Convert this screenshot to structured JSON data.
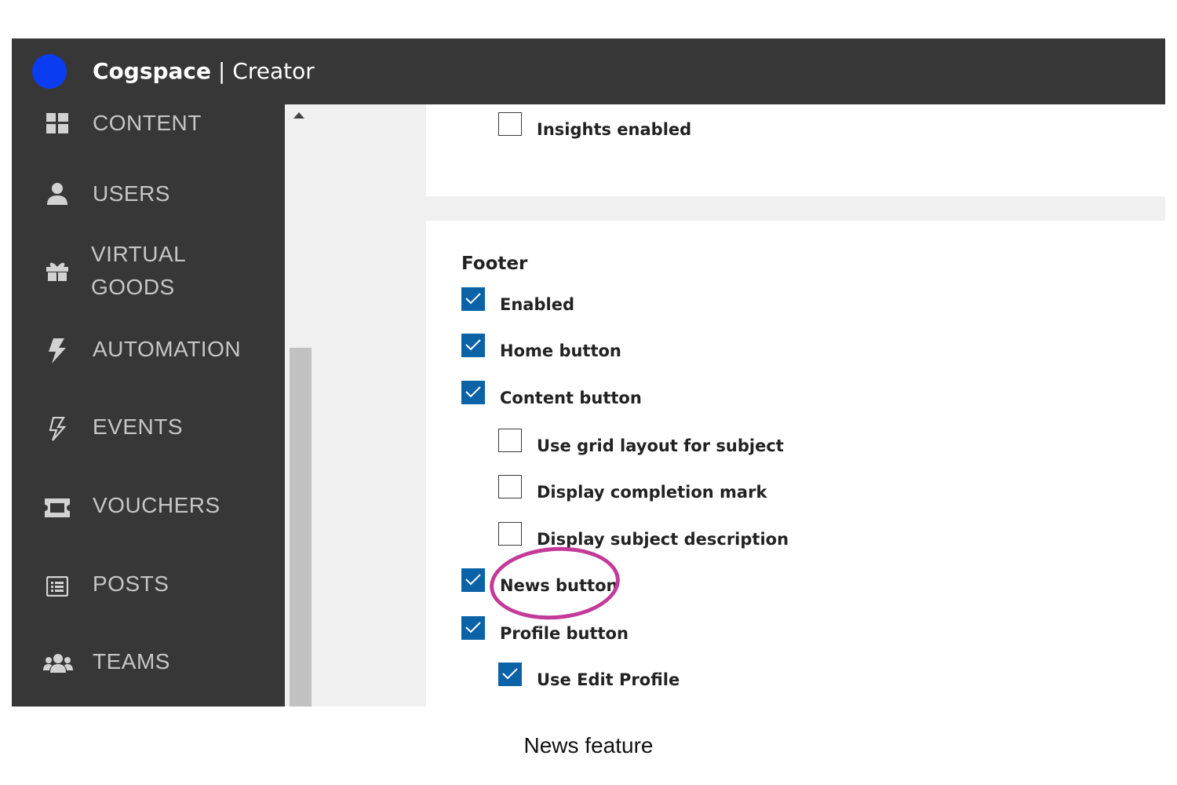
{
  "header": {
    "brand_name": "Cogspace",
    "brand_sub": " | Creator",
    "logo_color": "#0a3cf2",
    "bar_color": "#373737"
  },
  "sidebar": {
    "items": [
      {
        "label": "CONTENT",
        "icon": "grid-icon"
      },
      {
        "label": "USERS",
        "icon": "user-icon"
      },
      {
        "label": "VIRTUAL\nGOODS",
        "icon": "gift-icon"
      },
      {
        "label": "AUTOMATION",
        "icon": "bolt-icon"
      },
      {
        "label": "EVENTS",
        "icon": "bolt-outline-icon"
      },
      {
        "label": "VOUCHERS",
        "icon": "ticket-icon"
      },
      {
        "label": "POSTS",
        "icon": "list-icon"
      },
      {
        "label": "TEAMS",
        "icon": "users-icon"
      }
    ]
  },
  "settings": {
    "insights_enabled": {
      "label": "Insights enabled",
      "checked": false
    },
    "footer": {
      "title": "Footer",
      "options": [
        {
          "label": "Enabled",
          "checked": true,
          "indent": 0
        },
        {
          "label": "Home button",
          "checked": true,
          "indent": 0
        },
        {
          "label": "Content button",
          "checked": true,
          "indent": 0
        },
        {
          "label": "Use grid layout for subject",
          "checked": false,
          "indent": 1
        },
        {
          "label": "Display completion mark",
          "checked": false,
          "indent": 1
        },
        {
          "label": "Display subject description",
          "checked": false,
          "indent": 1
        },
        {
          "label": "News button",
          "checked": true,
          "indent": 0
        },
        {
          "label": "Profile button",
          "checked": true,
          "indent": 0
        },
        {
          "label": "Use Edit Profile",
          "checked": true,
          "indent": 1
        }
      ]
    },
    "checkbox_color": "#0b62a6"
  },
  "annotation": {
    "highlight_color": "#c33a99"
  },
  "caption": "News feature"
}
